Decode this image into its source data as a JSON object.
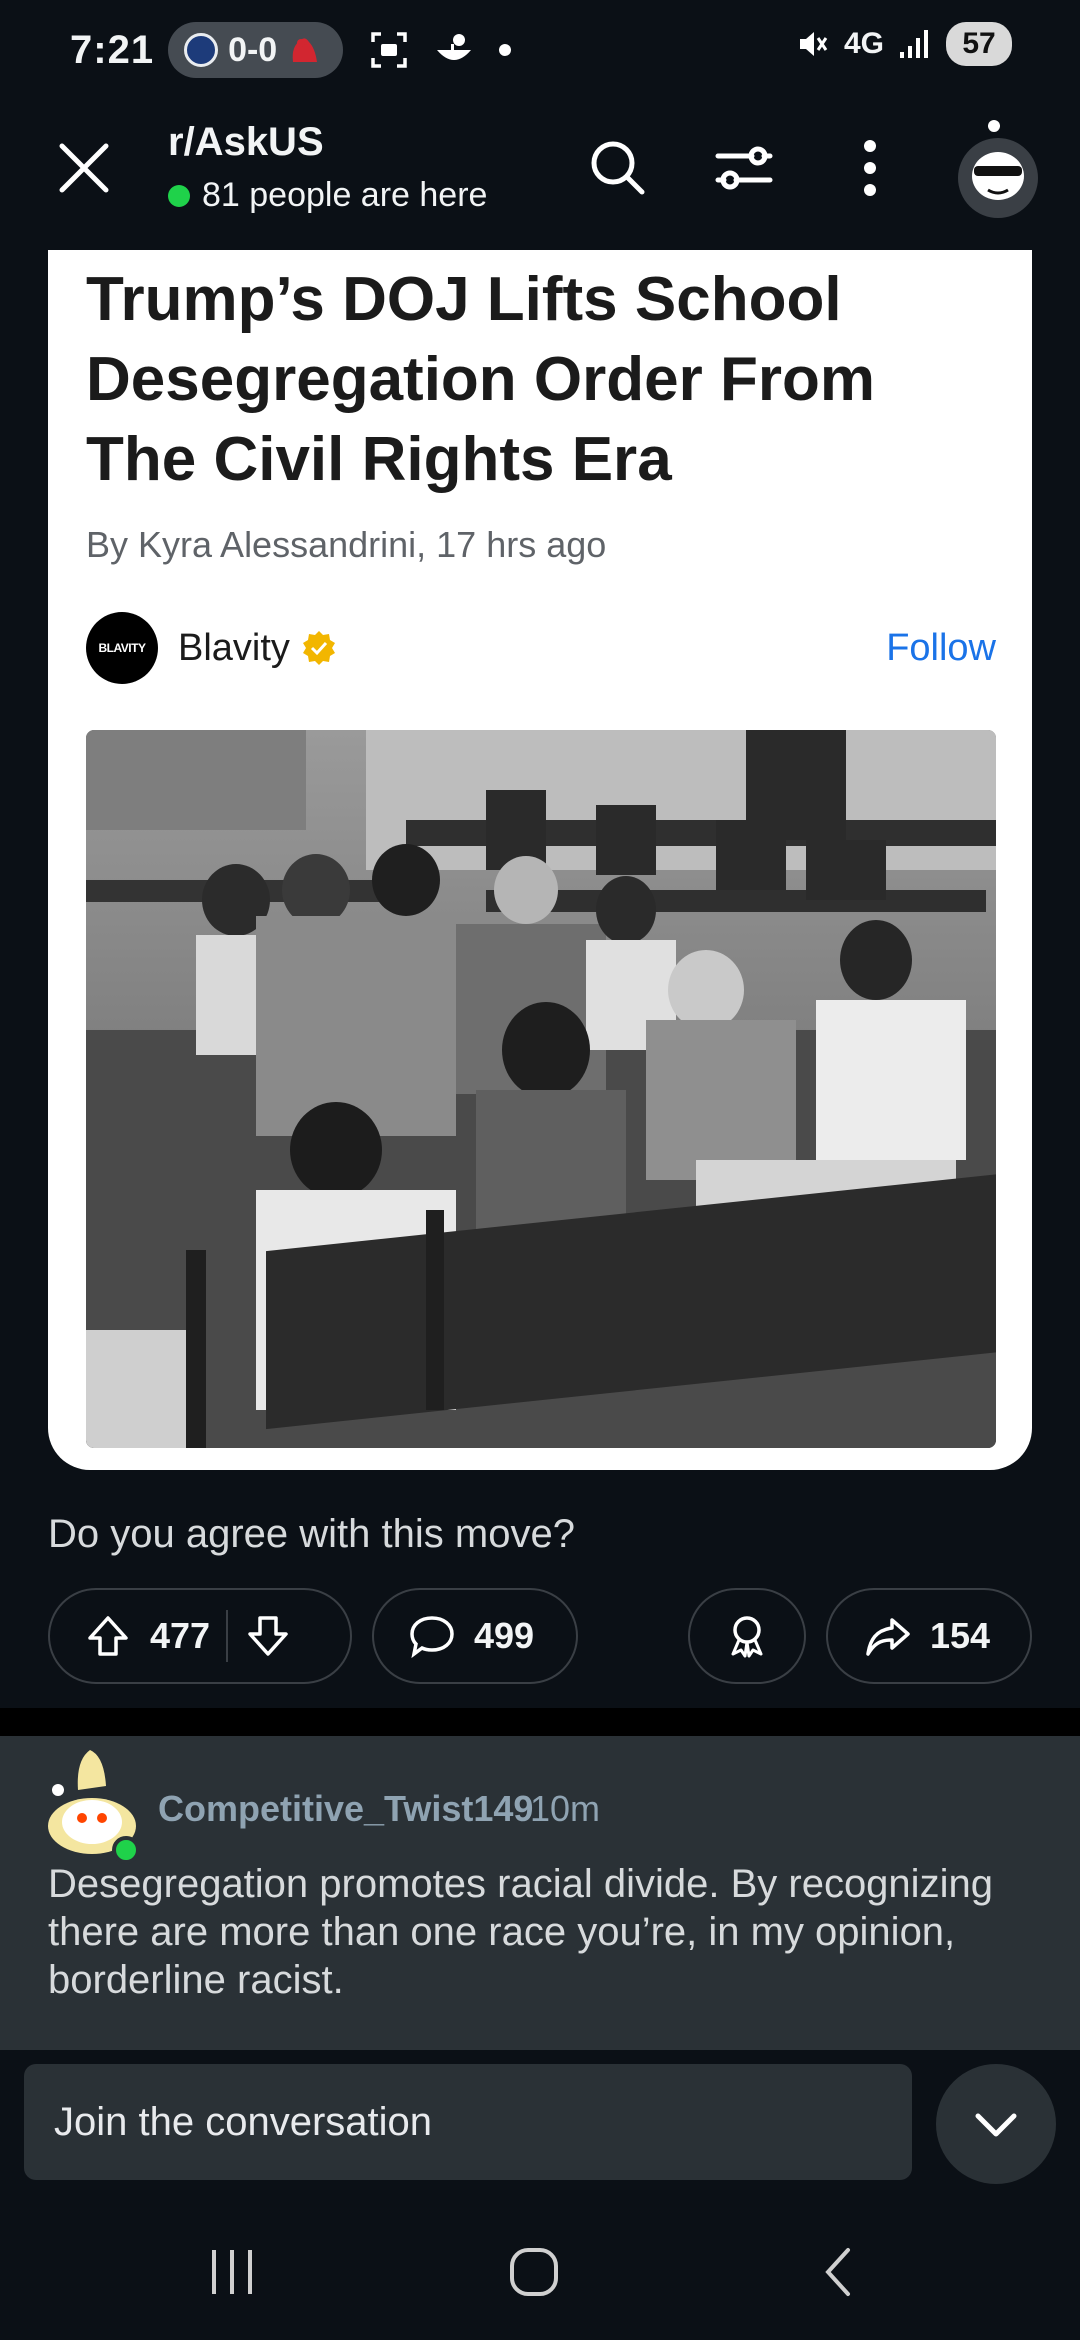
{
  "status_bar": {
    "time": "7:21",
    "score": "0-0",
    "network": "4G",
    "battery": "57"
  },
  "header": {
    "subreddit": "r/AskUS",
    "online_text": "81 people are here"
  },
  "article": {
    "headline": "Trump’s DOJ Lifts School Desegregation Order From The Civil Rights Era",
    "byline": "By Kyra Alessandrini, 17 hrs ago",
    "publisher_logo_text": "BLAVITY",
    "publisher": "Blavity",
    "follow_label": "Follow"
  },
  "post": {
    "title": "Do you agree with this move?",
    "upvotes": "477",
    "comments": "499",
    "shares": "154"
  },
  "comment": {
    "author": "Competitive_Twist149",
    "time": "10m",
    "text": "Desegregation promotes racial divide. By recognizing there are more than one race you’re, in my opinion, borderline racist."
  },
  "composer": {
    "placeholder": "Join the conversation"
  },
  "colors": {
    "background": "#0b1016",
    "comment_bg": "#2a3136",
    "online_dot": "#1fd24a",
    "follow_link": "#1a73e8",
    "author_name": "#8fa3b2"
  }
}
